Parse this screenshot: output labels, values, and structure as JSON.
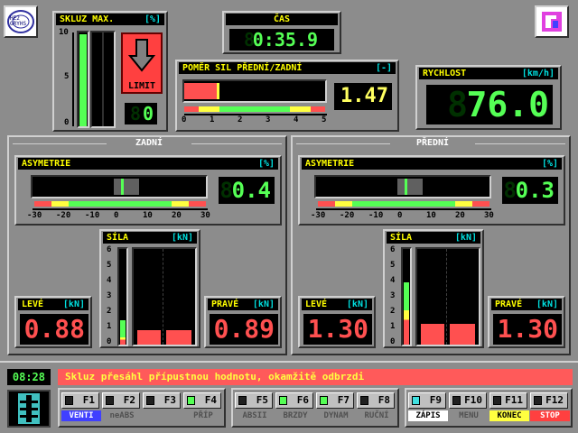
{
  "app": {
    "logo_text": "HE2 GRYHS"
  },
  "slip": {
    "title": "SKLUZ MAX.",
    "unit": "[%]",
    "ticks": [
      "10",
      "5",
      "0"
    ],
    "limit_label": "LIMIT",
    "counter_ghost": "8",
    "counter_value": "0",
    "bar_level": 0.98
  },
  "time": {
    "title": "ČAS",
    "ghost": "8",
    "value": "0:35.9"
  },
  "ratio": {
    "title": "POMĚR SIL PŘEDNÍ/ZADNÍ",
    "unit": "[-]",
    "ticks": [
      "0",
      "1",
      "2",
      "3",
      "4",
      "5"
    ],
    "ghost": "",
    "value": "1.47",
    "level": 0.247
  },
  "speed": {
    "title": "RYCHLOST",
    "unit": "[km/h]",
    "ghost": "8",
    "value": "76.0"
  },
  "rear": {
    "section": "ZADNÍ",
    "asym_title": "ASYMETRIE",
    "asym_unit": "[%]",
    "asym_ghost": "8",
    "asym_value": "0.4",
    "asym_ticks": [
      "-30",
      "-20",
      "-10",
      "0",
      "10",
      "20",
      "30"
    ],
    "force_title": "SÍLA",
    "force_unit": "[kN]",
    "force_ticks": [
      "6",
      "5",
      "4",
      "3",
      "2",
      "1",
      "0"
    ],
    "left_title": "LEVÉ",
    "left_unit": "[kN]",
    "left_value": "0.88",
    "right_title": "PRAVÉ",
    "right_unit": "[kN]",
    "right_value": "0.89",
    "left_level": 0.147,
    "right_level": 0.148,
    "mini_level": 0.25
  },
  "front": {
    "section": "PŘEDNÍ",
    "asym_title": "ASYMETRIE",
    "asym_unit": "[%]",
    "asym_ghost": "8",
    "asym_value": "0.3",
    "asym_ticks": [
      "-30",
      "-20",
      "-10",
      "0",
      "10",
      "20",
      "30"
    ],
    "force_title": "SÍLA",
    "force_unit": "[kN]",
    "force_ticks": [
      "6",
      "5",
      "4",
      "3",
      "2",
      "1",
      "0"
    ],
    "left_title": "LEVÉ",
    "left_unit": "[kN]",
    "left_value": "1.30",
    "right_title": "PRAVÉ",
    "right_unit": "[kN]",
    "right_value": "1.30",
    "left_level": 0.22,
    "right_level": 0.22,
    "mini_level": 0.65
  },
  "status": {
    "clock": "08:28",
    "message": "Skluz přesáhl přípustnou hodnotu, okamžitě odbrzdi"
  },
  "fkeys": [
    {
      "key": "F1",
      "label": "VENTI",
      "on": false
    },
    {
      "key": "F2",
      "label": "neABS",
      "on": false
    },
    {
      "key": "F3",
      "label": "",
      "on": false
    },
    {
      "key": "F4",
      "label": "PŘÍP",
      "on": true
    },
    {
      "key": "F5",
      "label": "ABSII",
      "on": false
    },
    {
      "key": "F6",
      "label": "BRZDY",
      "on": true
    },
    {
      "key": "F7",
      "label": "DYNAM",
      "on": true
    },
    {
      "key": "F8",
      "label": "RUČNÍ",
      "on": false
    },
    {
      "key": "F9",
      "label": "ZÁPIS",
      "on": true
    },
    {
      "key": "F10",
      "label": "MENU",
      "on": false
    },
    {
      "key": "F11",
      "label": "KONEC",
      "on": false
    },
    {
      "key": "F12",
      "label": "STOP",
      "on": false
    }
  ],
  "colors": {
    "seg_green": "#55ff55",
    "seg_red": "#ff5050",
    "header_yellow": "#ffff00",
    "unit_cyan": "#00e0e0",
    "msg_bg": "#ff5a5a",
    "msg_fg": "#ffff40"
  }
}
